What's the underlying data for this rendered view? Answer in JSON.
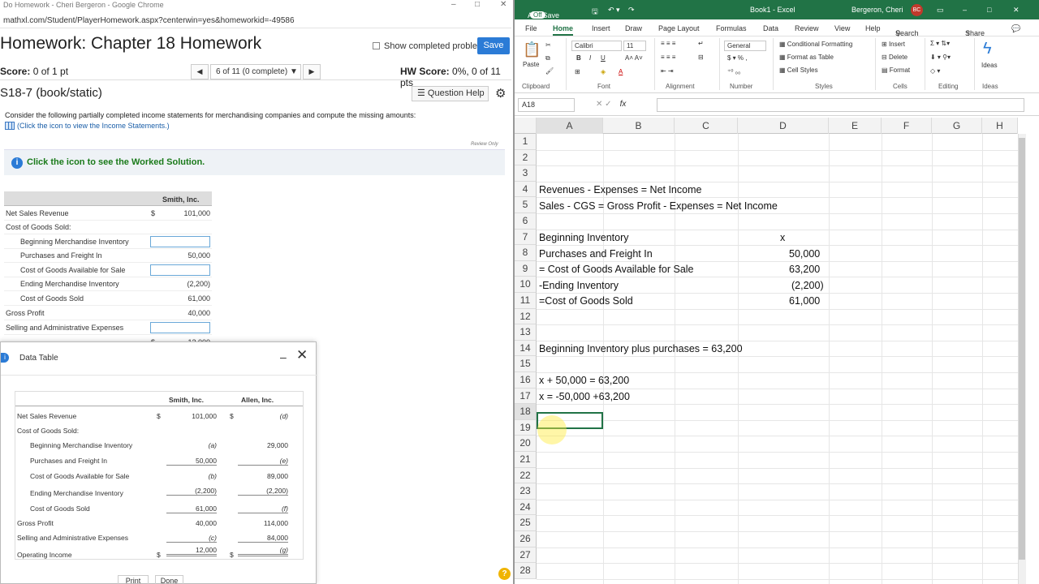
{
  "browser": {
    "title": "Do Homework - Cheri Bergeron - Google Chrome",
    "url": "mathxl.com/Student/PlayerHomework.aspx?centerwin=yes&homeworkid=-49586",
    "controls": [
      "–",
      "□",
      "✕"
    ]
  },
  "homework": {
    "title": "Homework: Chapter 18 Homework",
    "show_completed": "Show completed problem",
    "save": "Save",
    "score_label": "Score:",
    "score_value": " 0 of 1 pt",
    "pager": "6 of 11 (0 complete) ▼",
    "prev": "◀",
    "next": "▶",
    "hw_score_label": "HW Score:",
    "hw_score_value": " 0%, 0 of 11 pts",
    "question_id": "S18-7 (book/static)",
    "question_help": "Question Help",
    "consider": "Consider the following partially completed income statements for merchandising companies and compute the missing amounts:",
    "click_link": "(Click the icon to view the Income Statements.)",
    "review_only": "Review Only",
    "worked_solution": "Click the icon to see the Worked Solution.",
    "table": {
      "header": "Smith, Inc.",
      "rows": [
        {
          "label": "Net Sales Revenue",
          "dollar": "$",
          "value": "101,000"
        },
        {
          "label": "Cost of Goods Sold:",
          "dollar": "",
          "value": ""
        },
        {
          "label": "Beginning Merchandise Inventory",
          "dollar": "",
          "value": ""
        },
        {
          "label": "Purchases and Freight In",
          "dollar": "",
          "value": "50,000"
        },
        {
          "label": "Cost of Goods Available for Sale",
          "dollar": "",
          "value": ""
        },
        {
          "label": "Ending Merchandise Inventory",
          "dollar": "",
          "value": "(2,200)"
        },
        {
          "label": "Cost of Goods Sold",
          "dollar": "",
          "value": "61,000"
        },
        {
          "label": "Gross Profit",
          "dollar": "",
          "value": "40,000"
        },
        {
          "label": "Selling and Administrative Expenses",
          "dollar": "",
          "value": ""
        },
        {
          "label": "",
          "dollar": "$",
          "value": "12,000"
        }
      ]
    }
  },
  "data_table": {
    "title": "Data Table",
    "minimize": "–",
    "close": "✕",
    "col1": "Smith, Inc.",
    "col2": "Allen, Inc.",
    "rows": [
      {
        "label": "Net Sales Revenue",
        "d1": "$",
        "v1": "101,000",
        "d2": "$",
        "v2": "(d)"
      },
      {
        "label": "Cost of Goods Sold:",
        "d1": "",
        "v1": "",
        "d2": "",
        "v2": ""
      },
      {
        "label": "Beginning Merchandise Inventory",
        "d1": "",
        "v1": "(a)",
        "d2": "",
        "v2": "29,000"
      },
      {
        "label": "Purchases and Freight In",
        "d1": "",
        "v1": "50,000",
        "d2": "",
        "v2": "(e)"
      },
      {
        "label": "Cost of Goods Available for Sale",
        "d1": "",
        "v1": "(b)",
        "d2": "",
        "v2": "89,000"
      },
      {
        "label": "Ending Merchandise Inventory",
        "d1": "",
        "v1": "(2,200)",
        "d2": "",
        "v2": "(2,200)"
      },
      {
        "label": "Cost of Goods Sold",
        "d1": "",
        "v1": "61,000",
        "d2": "",
        "v2": "(f)"
      },
      {
        "label": "Gross Profit",
        "d1": "",
        "v1": "40,000",
        "d2": "",
        "v2": "114,000"
      },
      {
        "label": "Selling and Administrative Expenses",
        "d1": "",
        "v1": "(c)",
        "d2": "",
        "v2": "84,000"
      },
      {
        "label": "Operating Income",
        "d1": "$",
        "v1": "12,000",
        "d2": "$",
        "v2": "(g)"
      }
    ],
    "print": "Print",
    "done": "Done",
    "help": "?"
  },
  "excel": {
    "autosave": "AutoSave",
    "autosave_state": "Off",
    "title": "Book1 - Excel",
    "user": "Bergeron, Cheri",
    "initials": "BC",
    "tabs": [
      "File",
      "Home",
      "Insert",
      "Draw",
      "Page Layout",
      "Formulas",
      "Data",
      "Review",
      "View",
      "Help"
    ],
    "search": "Search",
    "share": "Share",
    "ribbon": {
      "paste": "Paste",
      "font": "Calibri",
      "size": "11",
      "number_format": "General",
      "conditional": "Conditional Formatting",
      "format_table": "Format as Table",
      "cell_styles": "Cell Styles",
      "insert": "Insert",
      "delete": "Delete",
      "format": "Format",
      "ideas": "Ideas",
      "groups": [
        "Clipboard",
        "Font",
        "Alignment",
        "Number",
        "Styles",
        "Cells",
        "Editing",
        "Ideas"
      ]
    },
    "name_box": "A18",
    "fx": "fx",
    "columns": [
      "A",
      "B",
      "C",
      "D",
      "E",
      "F",
      "G",
      "H"
    ],
    "rows": [
      "1",
      "2",
      "3",
      "4",
      "5",
      "6",
      "7",
      "8",
      "9",
      "10",
      "11",
      "12",
      "13",
      "14",
      "15",
      "16",
      "17",
      "18",
      "19",
      "20",
      "21",
      "22",
      "23",
      "24",
      "25",
      "26",
      "27",
      "28"
    ],
    "cells": {
      "a4": "Revenues - Expenses = Net Income",
      "a5": "Sales - CGS = Gross Profit - Expenses = Net Income",
      "a7": "Beginning Inventory",
      "d7": "x",
      "a8": "Purchases and Freight In",
      "d8": "50,000",
      "a9": "= Cost of Goods Available for Sale",
      "d9": "63,200",
      "a10": "-Ending Inventory",
      "d10": "(2,200)",
      "a11": "=Cost of Goods Sold",
      "d11": "61,000",
      "a14": "Beginning Inventory plus purchases = 63,200",
      "a16": "x + 50,000 = 63,200",
      "a17": "x = -50,000 +63,200"
    }
  }
}
